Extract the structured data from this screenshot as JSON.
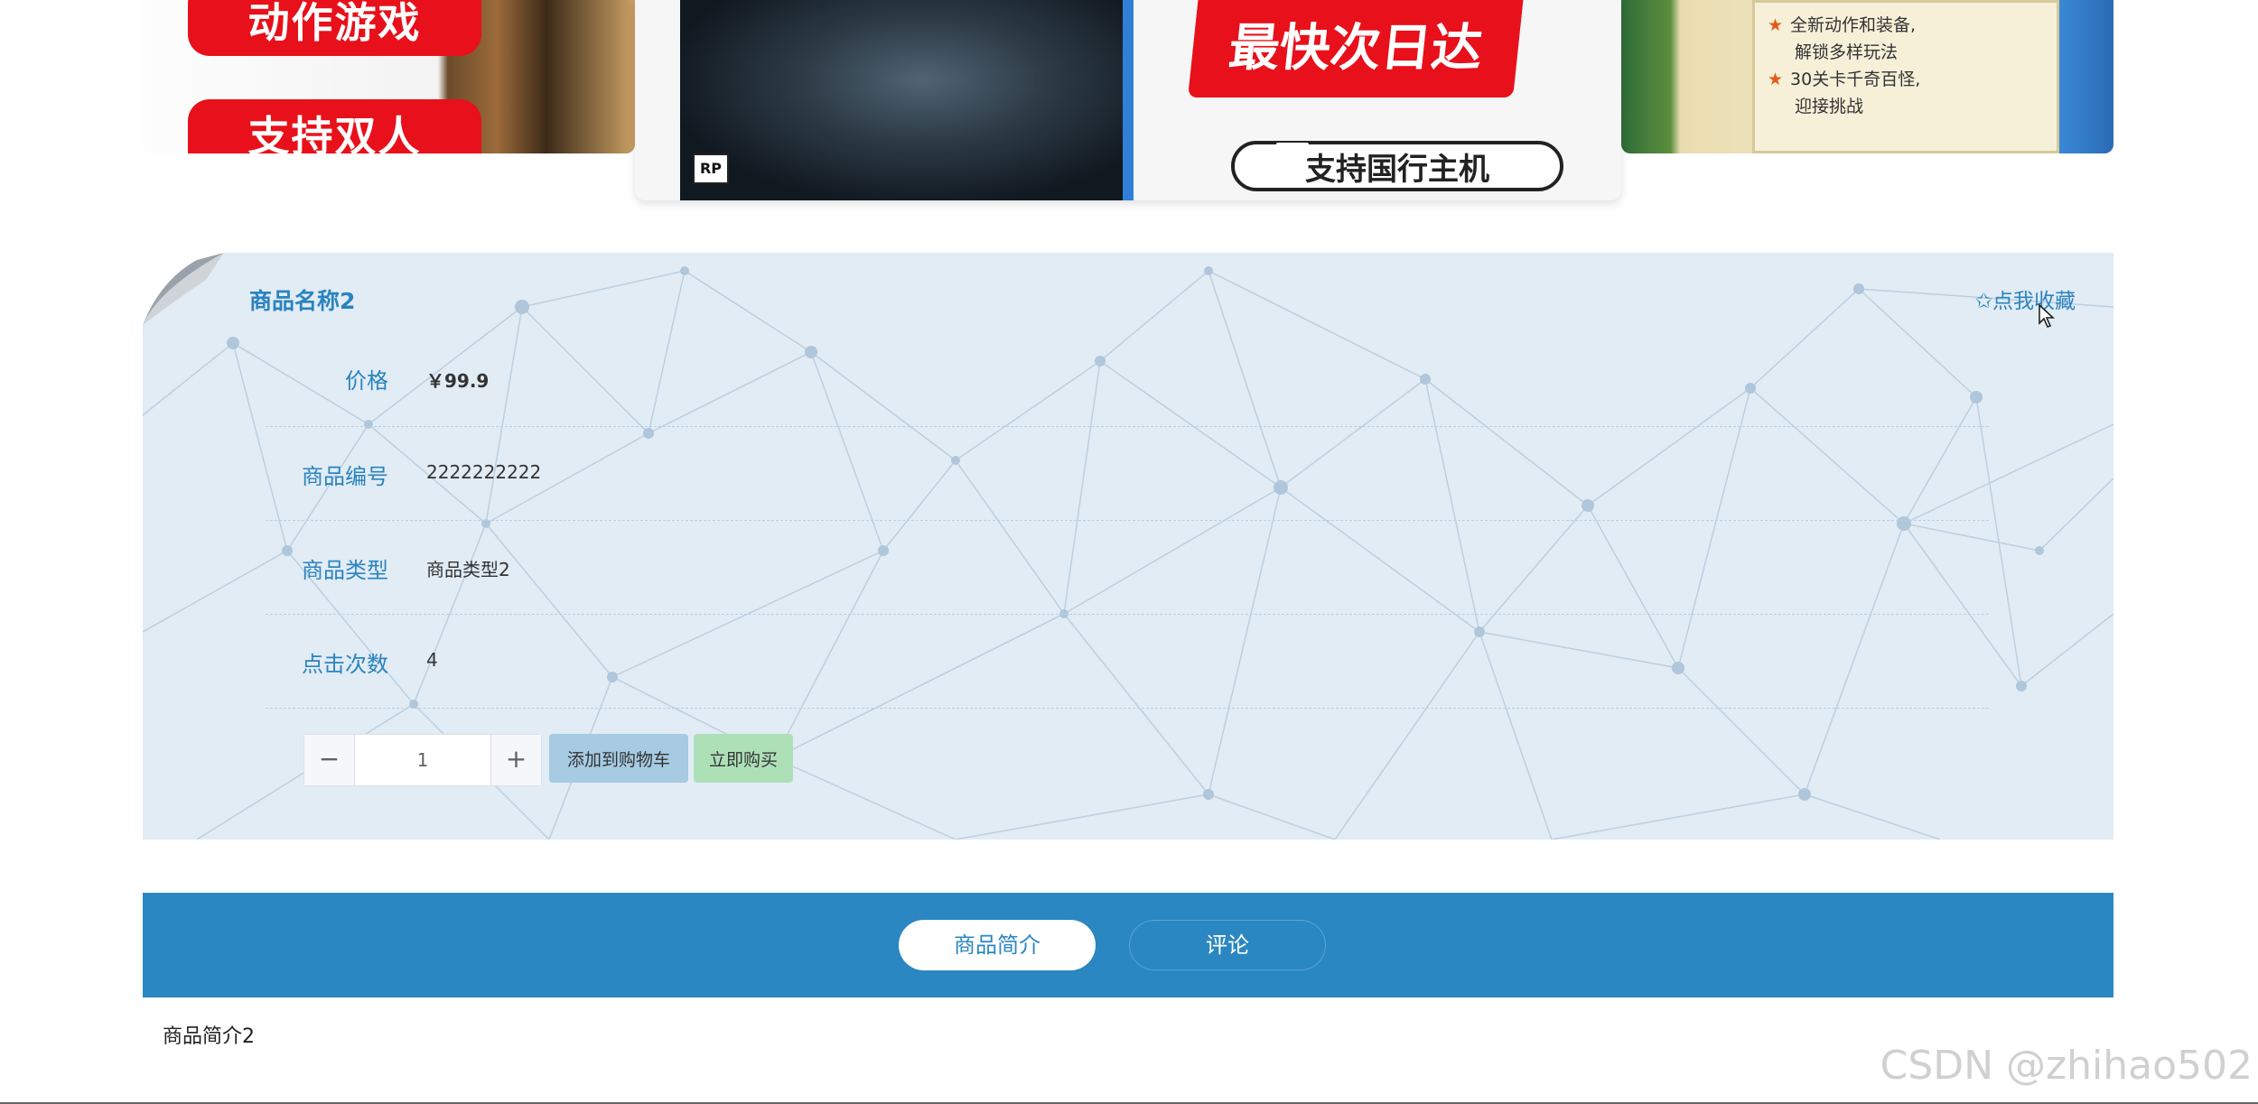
{
  "banner": {
    "left_slide": {
      "tag_top": "动作游戏",
      "tag_bottom": "支持双人"
    },
    "center_slide": {
      "cover_badge": "RP",
      "promo_line": "最快次日达",
      "console_note": "支持国行主机"
    },
    "right_slide": {
      "features": [
        "全新动作和装备,",
        "解锁多样玩法",
        "30关卡千奇百怪,",
        "迎接挑战"
      ]
    }
  },
  "product": {
    "name": "商品名称2",
    "favorite_label": "✩点我收藏",
    "fields": [
      {
        "label": "价格",
        "value": "￥99.9"
      },
      {
        "label": "商品编号",
        "value": "2222222222"
      },
      {
        "label": "商品类型",
        "value": "商品类型2"
      },
      {
        "label": "点击次数",
        "value": "4"
      }
    ],
    "quantity": {
      "minus": "−",
      "value": "1",
      "plus": "+"
    },
    "add_to_cart_label": "添加到购物车",
    "buy_now_label": "立即购买"
  },
  "tabs": [
    {
      "label": "商品简介",
      "active": true
    },
    {
      "label": "评论",
      "active": false
    }
  ],
  "intro_text": "商品简介2",
  "watermark": "CSDN @zhihao502",
  "colors": {
    "accent": "#2b87c1",
    "panel_bg": "#e1ecf5",
    "cart_button": "#a6cbe3",
    "buy_button": "#aee0b8"
  }
}
